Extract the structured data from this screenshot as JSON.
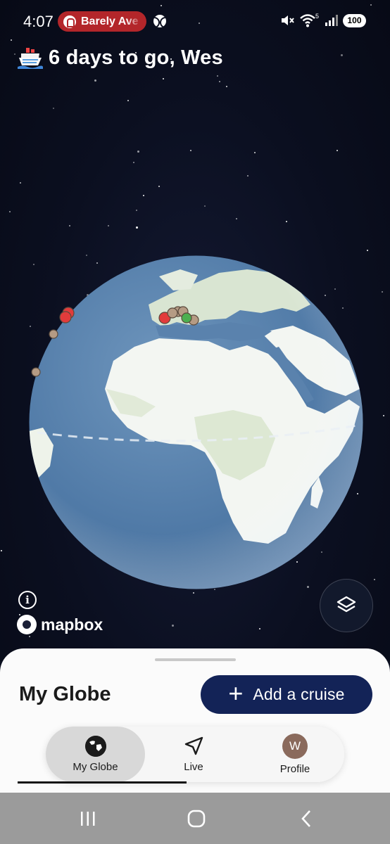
{
  "status_bar": {
    "time": "4:07",
    "now_playing_chip": "Barely Ave",
    "wifi_badge": "5",
    "battery": "100"
  },
  "header": {
    "ship_icon": "cruise-ship-icon",
    "title": "6 days to go, Wes"
  },
  "globe": {
    "markers": [
      {
        "region": "Atlantic",
        "color": "#e23b3b"
      },
      {
        "region": "Atlantic",
        "color": "#e23b3b"
      },
      {
        "region": "Atlantic",
        "color": "#b59b84"
      },
      {
        "region": "Atlantic",
        "color": "#b59b84"
      },
      {
        "region": "Mediterranean",
        "color": "#e23b3b"
      },
      {
        "region": "Mediterranean",
        "color": "#b59b84"
      },
      {
        "region": "Mediterranean",
        "color": "#4caf50"
      }
    ]
  },
  "map_attribution": {
    "info_icon": "info-icon",
    "brand": "mapbox"
  },
  "sheet": {
    "title": "My Globe",
    "add_cruise_label": "Add a cruise",
    "tabs": [
      {
        "label": "My Globe",
        "icon": "globe-icon",
        "active": true
      },
      {
        "label": "Live",
        "icon": "navigation-arrow-icon",
        "active": false
      },
      {
        "label": "Profile",
        "icon": "avatar",
        "avatar_initial": "W",
        "active": false
      }
    ]
  },
  "colors": {
    "primary_button": "#132357",
    "marker_red": "#e23b3b",
    "marker_green": "#4caf50",
    "marker_tan": "#b59b84",
    "chip": "#b3262a"
  }
}
